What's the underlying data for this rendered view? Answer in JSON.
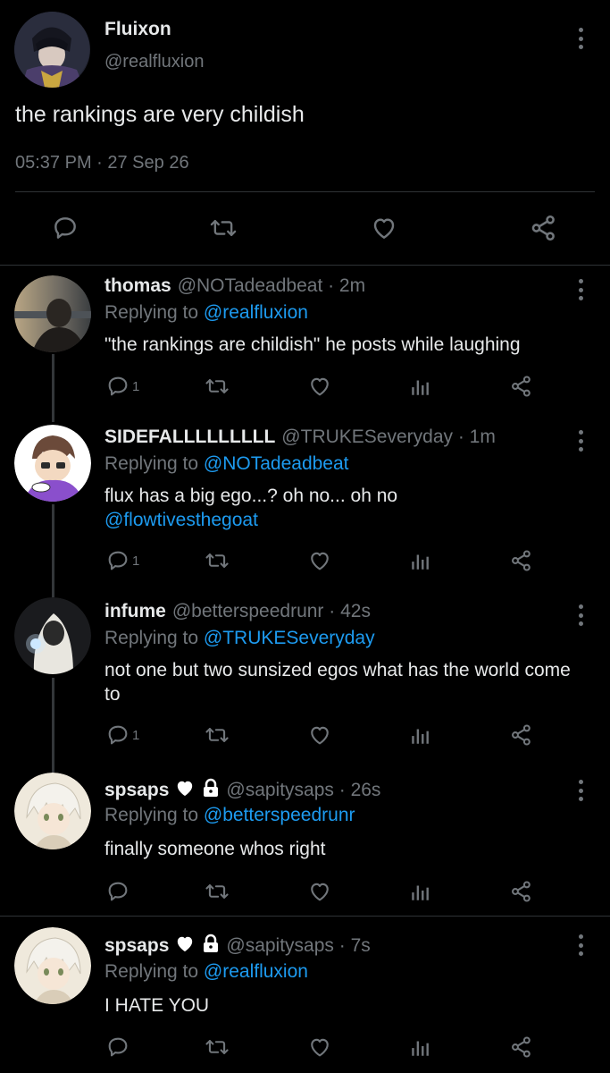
{
  "main_tweet": {
    "name": "Fluixon",
    "handle": "@realfluxion",
    "text": "the rankings are very childish",
    "meta": "05:37 PM · 27 Sep 26"
  },
  "replies": [
    {
      "name": "thomas",
      "handle": "@NOTadeadbeat · 2m",
      "replying_prefix": "Replying to",
      "replying_to": "@realfluxion",
      "text": "\"the rankings are childish\" he posts while laughing",
      "mention": "",
      "reply_count": "1"
    },
    {
      "name": "SIDEFALLLLLLLLL",
      "handle": "@TRUKESeveryday · 1m",
      "replying_prefix": "Replying to",
      "replying_to": "@NOTadeadbeat",
      "text": "flux has a big ego...? oh no... oh no",
      "mention": "@flowtivesthegoat",
      "reply_count": "1"
    },
    {
      "name": "infume",
      "handle": "@betterspeedrunr · 42s",
      "replying_prefix": "Replying to",
      "replying_to": "@TRUKESeveryday",
      "text": "not one but two sunsized egos what has the world come to",
      "mention": "",
      "reply_count": "1"
    },
    {
      "name": "spsaps",
      "handle": "@sapitysaps · 26s",
      "replying_prefix": "Replying to",
      "replying_to": "@betterspeedrunr",
      "text": "finally someone whos right",
      "mention": "",
      "reply_count": ""
    },
    {
      "name": "spsaps",
      "handle": "@sapitysaps · 7s",
      "replying_prefix": "Replying to",
      "replying_to": "@realfluxion",
      "text": "I HATE YOU",
      "mention": "",
      "reply_count": ""
    }
  ],
  "icons": {
    "reply": "reply-icon",
    "retweet": "retweet-icon",
    "like": "heart-icon",
    "views": "analytics-icon",
    "share": "share-icon",
    "more": "more-vertical-icon",
    "verified_heart": "white-heart-icon",
    "lock": "lock-icon"
  },
  "colors": {
    "background": "#000000",
    "text": "#e7e9ea",
    "muted": "#71767b",
    "link": "#1d9bf0",
    "divider": "#2f3336"
  }
}
